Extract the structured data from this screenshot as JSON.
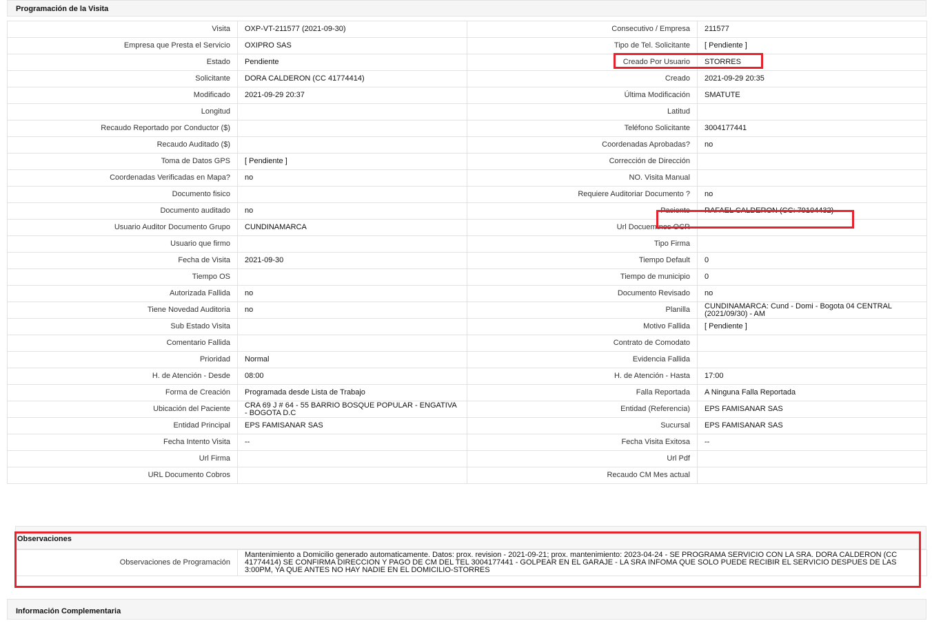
{
  "section1": {
    "title": "Programación de la Visita",
    "rows": [
      [
        "Visita",
        "OXP-VT-211577 (2021-09-30)",
        "Consecutivo / Empresa",
        "211577"
      ],
      [
        "Empresa que Presta el Servicio",
        "OXIPRO SAS",
        "Tipo de Tel. Solicitante",
        "[ Pendiente ]"
      ],
      [
        "Estado",
        "Pendiente",
        "Creado Por Usuario",
        "STORRES"
      ],
      [
        "Solicitante",
        "DORA CALDERON (CC 41774414)",
        "Creado",
        "2021-09-29 20:35"
      ],
      [
        "Modificado",
        "2021-09-29 20:37",
        "Última Modificación",
        "SMATUTE"
      ],
      [
        "Longitud",
        "",
        "Latitud",
        ""
      ],
      [
        "Recaudo Reportado por Conductor ($)",
        "",
        "Teléfono Solicitante",
        "3004177441"
      ],
      [
        "Recaudo Auditado ($)",
        "",
        "Coordenadas Aprobadas?",
        "no"
      ],
      [
        "Toma de Datos GPS",
        "[ Pendiente ]",
        "Corrección de Dirección",
        ""
      ],
      [
        "Coordenadas Verificadas en Mapa?",
        "no",
        "NO. Visita Manual",
        ""
      ],
      [
        "Documento fisico",
        "",
        "Requiere Auditoriar Documento ?",
        "no"
      ],
      [
        "Documento auditado",
        "no",
        "Paciente",
        "RAFAEL CALDERON (CC: 79104432)"
      ],
      [
        "Usuario Auditor Documento Grupo",
        "CUNDINAMARCA",
        "Url Docuemtnos OCR",
        ""
      ],
      [
        "Usuario que firmo",
        "",
        "Tipo Firma",
        ""
      ],
      [
        "Fecha de Visita",
        "2021-09-30",
        "Tiempo Default",
        "0"
      ],
      [
        "Tiempo OS",
        "",
        "Tiempo de municipio",
        "0"
      ],
      [
        "Autorizada Fallida",
        "no",
        "Documento Revisado",
        "no"
      ],
      [
        "Tiene Novedad Auditoria",
        "no",
        "Planilla",
        "CUNDINAMARCA: Cund - Domi - Bogota 04 CENTRAL (2021/09/30) - AM"
      ],
      [
        "Sub Estado Visita",
        "",
        "Motivo Fallida",
        "[ Pendiente ]"
      ],
      [
        "Comentario Fallida",
        "",
        "Contrato de Comodato",
        ""
      ],
      [
        "Prioridad",
        "Normal",
        "Evidencia Fallida",
        ""
      ],
      [
        "H. de Atención - Desde",
        "08:00",
        "H. de Atención - Hasta",
        "17:00"
      ],
      [
        "Forma de Creación",
        "Programada desde Lista de Trabajo",
        "Falla Reportada",
        "A Ninguna Falla Reportada"
      ],
      [
        "Ubicación del Paciente",
        "CRA 69 J # 64 - 55 BARRIO BOSQUE POPULAR - ENGATIVA - BOGOTA D.C",
        "Entidad (Referencia)",
        "EPS FAMISANAR SAS"
      ],
      [
        "Entidad Principal",
        "EPS FAMISANAR SAS",
        "Sucursal",
        "EPS FAMISANAR SAS"
      ],
      [
        "Fecha Intento Visita",
        "--",
        "Fecha Visita Exitosa",
        "--"
      ],
      [
        "Url Firma",
        "",
        "Url Pdf",
        ""
      ],
      [
        "URL Documento Cobros",
        "",
        "Recaudo CM Mes actual",
        ""
      ]
    ]
  },
  "section2": {
    "title": "Observaciones",
    "label": "Observaciones de Programación",
    "value": "Mantenimiento a Domicilio generado automaticamente. Datos: prox. revision - 2021-09-21; prox. mantenimiento: 2023-04-24 - SE PROGRAMA SERVICIO CON LA SRA. DORA CALDERON (CC 41774414) SE CONFIRMA DIRECCION Y PAGO DE CM DEL TEL 3004177441 - GOLPEAR EN EL GARAJE - LA SRA INFOMA QUE SOLO PUEDE RECIBIR EL SERVICIO DESPUES DE LAS 3:00PM, YA QUE ANTES NO HAY NADIE EN EL DOMICILIO-STORRES"
  },
  "section3": {
    "title": "Información Complementaria"
  },
  "colors": {
    "highlight": "#e5212b",
    "header_bg": "#f5f5f5",
    "border": "#e2e2e2"
  }
}
